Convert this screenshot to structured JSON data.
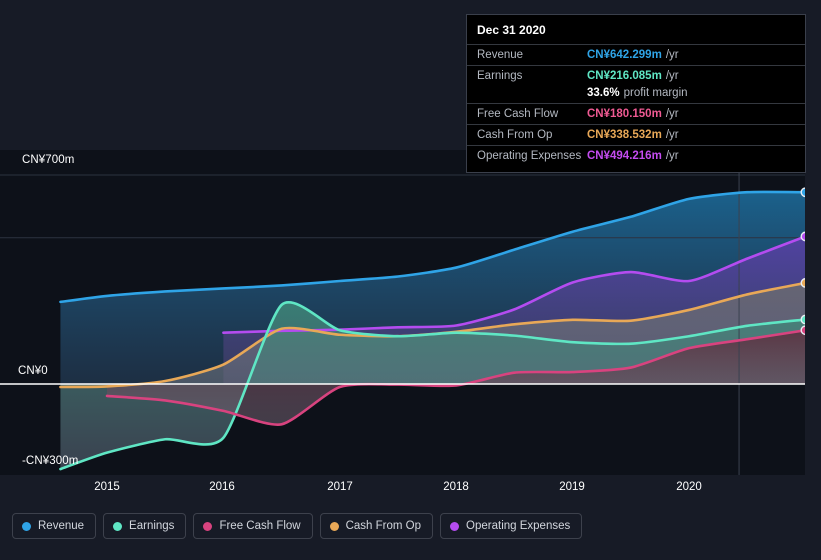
{
  "chart_data": {
    "type": "area",
    "title": "",
    "xlabel": "",
    "ylabel": "",
    "currency_prefix": "CN¥",
    "ylim": [
      -300,
      700
    ],
    "ytick_labels": [
      "CN¥700m",
      "CN¥0",
      "-CN¥300m"
    ],
    "ytick_values": [
      700,
      0,
      -300
    ],
    "grid": true,
    "gridlines": [
      700,
      490
    ],
    "zero_line": 0,
    "legend_position": "bottom-left",
    "x": [
      2014.6,
      2015.0,
      2015.5,
      2016.0,
      2016.5,
      2017.0,
      2017.5,
      2018.0,
      2018.5,
      2019.0,
      2019.5,
      2020.0,
      2020.5,
      2021.0
    ],
    "xtick_labels": [
      "2015",
      "2016",
      "2017",
      "2018",
      "2019",
      "2020"
    ],
    "xtick_values": [
      2015,
      2016,
      2017,
      2018,
      2019,
      2020
    ],
    "series": [
      {
        "name": "Revenue",
        "color": "#2fa4e7",
        "fill_top": "#1d6fa0",
        "fill_bottom": "#2a4766",
        "start_x": 2014.6,
        "values": [
          275,
          295,
          310,
          320,
          330,
          345,
          360,
          390,
          450,
          510,
          560,
          620,
          642.3,
          642.299
        ]
      },
      {
        "name": "Operating Expenses",
        "color": "#b44cf0",
        "fill_top": "#5a3fa8",
        "fill_bottom": "#4a4470",
        "start_x": 2016.0,
        "values": [
          null,
          null,
          null,
          172,
          178,
          182,
          190,
          196,
          250,
          340,
          375,
          345,
          420,
          494.216
        ]
      },
      {
        "name": "Cash From Op",
        "color": "#e8a857",
        "fill_top": "#6b6a6e",
        "fill_bottom": "#6e7480",
        "start_x": 2014.6,
        "values": [
          -10,
          -8,
          10,
          65,
          185,
          165,
          160,
          175,
          200,
          215,
          212,
          248,
          300,
          338.532
        ]
      },
      {
        "name": "Earnings",
        "color": "#5fe6c4",
        "fill_top": "#3e8878",
        "fill_bottom": "#5d6a7c",
        "start_x": 2014.6,
        "values": [
          -285,
          -230,
          -185,
          -180,
          265,
          180,
          160,
          172,
          162,
          140,
          135,
          160,
          195,
          216.085
        ]
      },
      {
        "name": "Free Cash Flow",
        "color": "#d8437f",
        "fill_top": "#5e2b3c",
        "fill_bottom": "#6e6070",
        "start_x": 2015.0,
        "values": [
          null,
          -40,
          -55,
          -90,
          -135,
          -10,
          -2,
          -5,
          38,
          40,
          55,
          120,
          150,
          180.15
        ]
      }
    ]
  },
  "tooltip": {
    "date": "Dec 31 2020",
    "rows": [
      {
        "label": "Revenue",
        "value": "CN¥642.299m",
        "unit": "/yr",
        "color": "#2fa4e7"
      },
      {
        "label": "Earnings",
        "value": "CN¥216.085m",
        "unit": "/yr",
        "color": "#5fe6c4"
      },
      {
        "label": "",
        "value": "33.6%",
        "margin_text": "profit margin",
        "color": "#ffffff"
      },
      {
        "label": "Free Cash Flow",
        "value": "CN¥180.150m",
        "unit": "/yr",
        "color": "#ef5a93"
      },
      {
        "label": "Cash From Op",
        "value": "CN¥338.532m",
        "unit": "/yr",
        "color": "#e8a857"
      },
      {
        "label": "Operating Expenses",
        "value": "CN¥494.216m",
        "unit": "/yr",
        "color": "#c44cf0"
      }
    ]
  },
  "legend": {
    "items": [
      {
        "label": "Revenue",
        "color": "#2fa4e7"
      },
      {
        "label": "Earnings",
        "color": "#5fe6c4"
      },
      {
        "label": "Free Cash Flow",
        "color": "#d8437f"
      },
      {
        "label": "Cash From Op",
        "color": "#e8a857"
      },
      {
        "label": "Operating Expenses",
        "color": "#b44cf0"
      }
    ]
  },
  "colors": {
    "page_background": "#171b26",
    "plot_background": "#0d1119",
    "gridline": "#2c3340",
    "zero_line": "#ffffff",
    "axis_text": "#ffffff",
    "tooltip_background": "#000000",
    "tooltip_border": "#3a3f4b",
    "tooltip_label": "#b4b9c2"
  }
}
